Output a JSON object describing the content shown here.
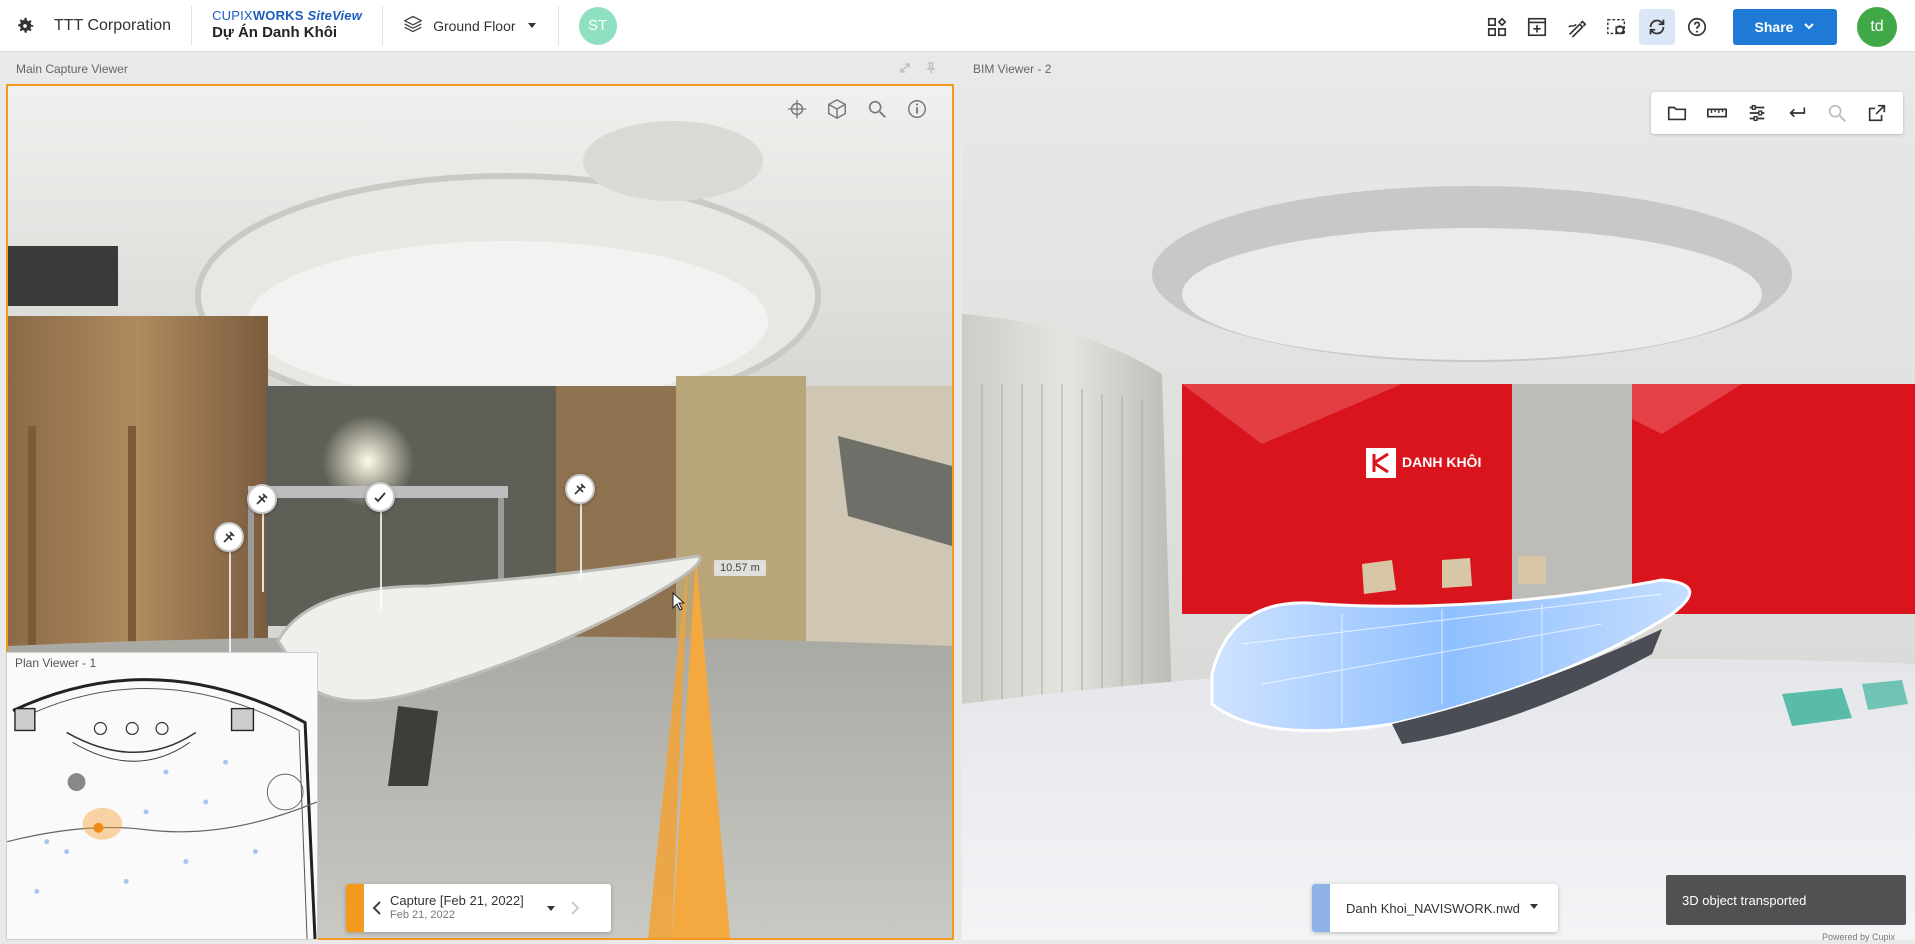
{
  "topbar": {
    "org_name": "TTT Corporation",
    "brand_prefix": "CUPIX",
    "brand_works": "WORKS",
    "brand_site": "SiteView",
    "project_name": "Dự Án Danh Khôi",
    "floor": "Ground Floor",
    "avatar_left": "ST",
    "share_label": "Share",
    "avatar_right": "td",
    "icons": [
      "layout-icon",
      "add-panel-icon",
      "markup-icon",
      "capture-select-icon",
      "sync-icon",
      "help-icon"
    ]
  },
  "main_viewer": {
    "title": "Main Capture Viewer",
    "measurement": "10.57 m",
    "tools": [
      "compare-icon",
      "cube-icon",
      "zoom-icon",
      "info-icon"
    ]
  },
  "bim_viewer": {
    "title": "BIM Viewer - 2",
    "tools": [
      "folder-icon",
      "ruler-icon",
      "sliders-icon",
      "undo-icon",
      "zoom-icon",
      "open-external-icon"
    ],
    "logo_text": "DANH KHÔI"
  },
  "plan_viewer": {
    "title": "Plan Viewer - 1"
  },
  "capture": {
    "title": "Capture [Feb 21, 2022]",
    "date": "Feb 21, 2022"
  },
  "model": {
    "name": "Danh Khoi_NAVISWORK.nwd"
  },
  "toast": "3D object transported",
  "powered_by": "Powered by Cupix",
  "colors": {
    "accent_orange": "#f39a1e",
    "primary_blue": "#1f7ad6",
    "bim_red": "#d9141c"
  }
}
